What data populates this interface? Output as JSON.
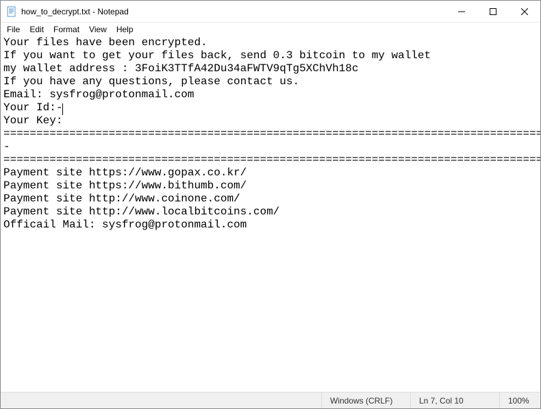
{
  "titlebar": {
    "title": "how_to_decrypt.txt - Notepad"
  },
  "menu": {
    "file": "File",
    "edit": "Edit",
    "format": "Format",
    "view": "View",
    "help": "Help"
  },
  "content": {
    "lines": [
      "Your files have been encrypted.",
      "If you want to get your files back, send 0.3 bitcoin to my wallet",
      "my wallet address : 3FoiK3TTfA42Du34aFWTV9qTg5XChVh18c",
      "If you have any questions, please contact us.",
      "Email: sysfrog@protonmail.com",
      "",
      "Your Id:-",
      "Your Key:",
      "===================================================================================",
      "-",
      "===================================================================================",
      "",
      "Payment site https://www.gopax.co.kr/",
      "Payment site https://www.bithumb.com/",
      "Payment site http://www.coinone.com/",
      "Payment site http://www.localbitcoins.com/",
      "Officail Mail: sysfrog@protonmail.com"
    ]
  },
  "statusbar": {
    "encoding": "Windows (CRLF)",
    "position": "Ln 7, Col 10",
    "zoom": "100%"
  }
}
